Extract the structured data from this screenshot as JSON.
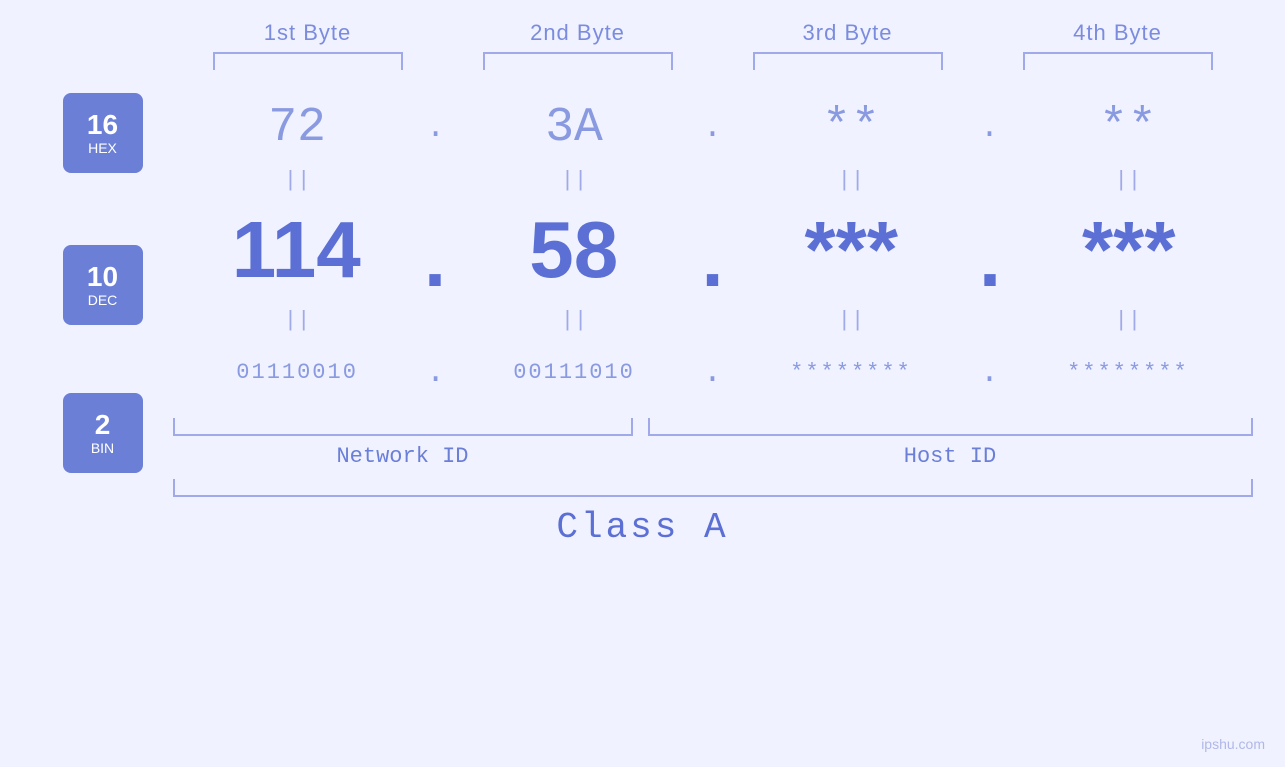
{
  "header": {
    "byte1_label": "1st Byte",
    "byte2_label": "2nd Byte",
    "byte3_label": "3rd Byte",
    "byte4_label": "4th Byte"
  },
  "badges": {
    "hex": {
      "number": "16",
      "label": "HEX"
    },
    "dec": {
      "number": "10",
      "label": "DEC"
    },
    "bin": {
      "number": "2",
      "label": "BIN"
    }
  },
  "hex_row": {
    "byte1": "72",
    "byte2": "3A",
    "byte3": "**",
    "byte4": "**",
    "sep": "."
  },
  "dec_row": {
    "byte1": "114",
    "byte2": "58",
    "byte3": "***",
    "byte4": "***",
    "sep": "."
  },
  "bin_row": {
    "byte1": "01110010",
    "byte2": "00111010",
    "byte3": "********",
    "byte4": "********",
    "sep": "."
  },
  "labels": {
    "network_id": "Network ID",
    "host_id": "Host ID",
    "class": "Class A"
  },
  "watermark": "ipshu.com",
  "eq_sign": "||"
}
